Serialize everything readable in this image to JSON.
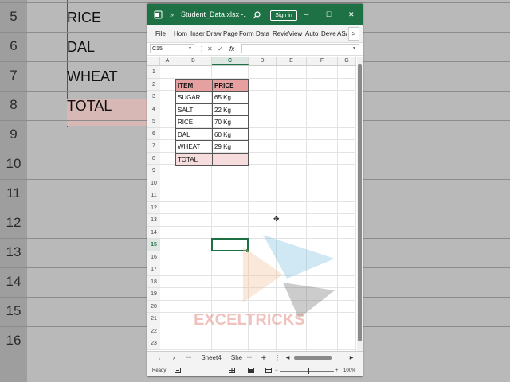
{
  "background": {
    "rows": [
      {
        "num": "5",
        "item": "RICE"
      },
      {
        "num": "6",
        "item": "DAL"
      },
      {
        "num": "7",
        "item": "WHEAT"
      },
      {
        "num": "8",
        "item": "TOTAL"
      },
      {
        "num": "9",
        "item": ""
      },
      {
        "num": "10",
        "item": ""
      },
      {
        "num": "11",
        "item": ""
      },
      {
        "num": "12",
        "item": ""
      },
      {
        "num": "13",
        "item": ""
      },
      {
        "num": "14",
        "item": ""
      },
      {
        "num": "15",
        "item": ""
      },
      {
        "num": "16",
        "item": ""
      }
    ]
  },
  "titlebar": {
    "app_icon": "excel-icon",
    "expand": "»",
    "filename": "Student_Data.xlsx -...",
    "search_icon": "search-icon",
    "sign_in": "Sign in",
    "minimize": "─",
    "maximize": "☐",
    "close": "✕"
  },
  "menubar": {
    "items": [
      "File",
      "Hom",
      "Inser",
      "Draw",
      "Page",
      "Form",
      "Data",
      "Revie",
      "View",
      "Auto",
      "Deve",
      "ASA"
    ],
    "more": ">"
  },
  "formula_bar": {
    "name_box": "C15",
    "cancel": "✕",
    "confirm": "✓",
    "fx": "fx",
    "value": ""
  },
  "columns": [
    "A",
    "B",
    "C",
    "D",
    "E",
    "F",
    "G"
  ],
  "selected_column": "C",
  "rows": [
    "1",
    "2",
    "3",
    "4",
    "5",
    "6",
    "7",
    "8",
    "9",
    "10",
    "11",
    "12",
    "13",
    "14",
    "15",
    "16",
    "17",
    "18",
    "19",
    "20",
    "21",
    "22",
    "23"
  ],
  "selected_row": "15",
  "table": {
    "header": [
      "ITEM",
      "PRICE"
    ],
    "rows": [
      [
        "SUGAR",
        "65 Kg"
      ],
      [
        "SALT",
        "22 Kg"
      ],
      [
        "RICE",
        "70 Kg"
      ],
      [
        "DAL",
        "60 Kg"
      ],
      [
        "WHEAT",
        "29 Kg"
      ]
    ],
    "total_label": "TOTAL",
    "total_value": "",
    "header_color": "#e6a09f",
    "total_color": "#f6dcdc"
  },
  "sheet_tabs": {
    "prev": "‹",
    "next": "›",
    "dots": "•••",
    "active_sheet": "Sheet4",
    "partial_sheet": "She",
    "add": "+"
  },
  "status_bar": {
    "ready": "Ready",
    "zoom": "100%",
    "zoom_minus": "−",
    "zoom_plus": "+"
  },
  "watermark": {
    "text": "EXCELTRICKS"
  },
  "accent_color": "#1e7145"
}
